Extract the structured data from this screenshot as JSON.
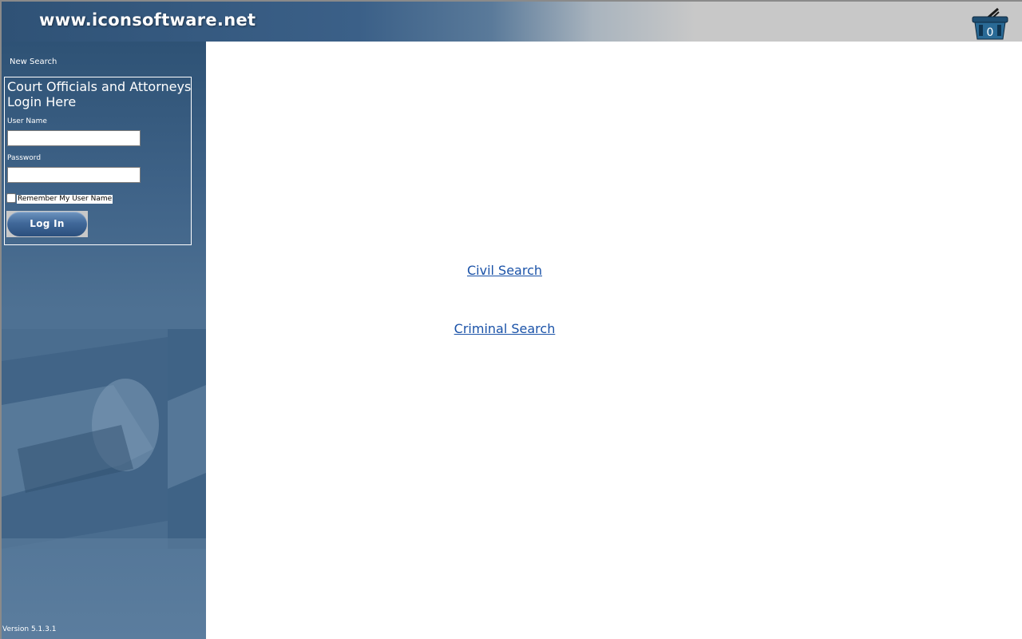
{
  "header": {
    "site_title": "www.iconsoftware.net",
    "cart_count": "0",
    "cart_icon": "shopping-basket-icon"
  },
  "sidebar": {
    "new_search": "New Search",
    "login": {
      "title": "Court Officials and Attorneys Login Here",
      "username_label": "User Name",
      "username_value": "",
      "password_label": "Password",
      "password_value": "",
      "remember_label": "Remember My User Name",
      "remember_checked": false,
      "button_label": "Log In"
    },
    "version": "Version 5.1.3.1"
  },
  "main": {
    "links": [
      {
        "label": "Civil Search"
      },
      {
        "label": "Criminal Search"
      }
    ]
  },
  "colors": {
    "header_dark": "#2f5276",
    "header_light": "#c8c8c8",
    "sidebar": "#4e7193",
    "link": "#1a52a8",
    "button": "#41699a"
  }
}
